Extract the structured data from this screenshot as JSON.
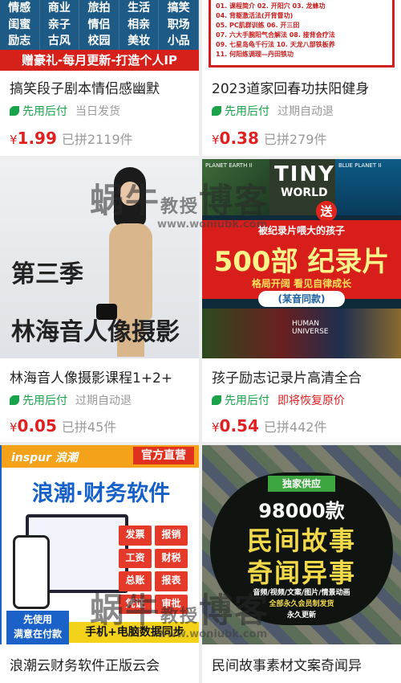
{
  "products": [
    {
      "title": "搞笑段子剧本情侣感幽默",
      "pay_badge": "先用后付",
      "shipping": "当日发货",
      "currency": "¥",
      "price": "1.99",
      "sold": "已拼2119件",
      "banner": {
        "tags": [
          "情感",
          "商业",
          "旅拍",
          "生活",
          "搞笑",
          "闺蜜",
          "亲子",
          "情侣",
          "相亲",
          "职场",
          "励志",
          "古风",
          "校园",
          "美妆",
          "小品"
        ],
        "strip": "赠豪礼-每月更新-打造个人IP"
      }
    },
    {
      "title": "2023道家回春功扶阳健身",
      "pay_badge": "先用后付",
      "shipping": "过期自动退",
      "currency": "¥",
      "price": "0.38",
      "sold": "已拼279件",
      "banner": {
        "lines": [
          "01. 课程简介  02. 开阳穴  03. 龙蜂功",
          "04. 背躯激活法(开背督功)",
          "05. PC肌群训练  06. 开三田",
          "07. 六大手腕阳气合解法  08. 接背会疗法",
          "09. 七星岛龟千行法  10. 天龙八部铁板养",
          "11. 何阳练调理—丹田铁功"
        ]
      }
    },
    {
      "title": "林海音人像摄影课程1+2+",
      "pay_badge": "先用后付",
      "shipping": "过期自动退",
      "currency": "¥",
      "price": "0.05",
      "sold": "已拼45件",
      "banner": {
        "season": "第三季",
        "name": "林海音人像摄影"
      }
    },
    {
      "title": "孩子励志记录片高清全合",
      "pay_badge": "先用后付",
      "shipping": "即将恢复原价",
      "currency": "¥",
      "price": "0.54",
      "sold": "已拼442件",
      "banner": {
        "top_left": "PLANET EARTH II",
        "tiny": "TINY",
        "world": "WORLD",
        "blue": "BLUE PLANET II",
        "send": "送",
        "pitch": "被纪录片喂大的孩子",
        "big": "500部 纪录片",
        "slogan": "格局开阔 看见自律成长",
        "same": "(某音同款)",
        "human": "HUMAN UNIVERSE"
      }
    },
    {
      "title": "浪潮云财务软件正版云会",
      "banner": {
        "brand": "inspur 浪潮",
        "official": "官方直营",
        "headline": "浪潮·财务软件",
        "buttons": [
          "发票",
          "报销",
          "工资",
          "财税",
          "总账",
          "报表",
          "凭证",
          "审批"
        ],
        "tag_line1": "先使用",
        "tag_line2": "满意在付款",
        "sync": "手机+电脑数据同步"
      }
    },
    {
      "title": "民间故事素材文案奇闻异",
      "banner": {
        "exclusive": "独家供应",
        "count": "98000款",
        "line1": "民间故事",
        "line2": "奇闻异事",
        "sub1": "音频/视频/文案/图片/情景动画",
        "sub2": "全部永久会员制发货",
        "sub3": "永久更新"
      }
    }
  ],
  "watermark": {
    "brand": "蜗牛",
    "teach": "教授",
    "blog": "博客",
    "url": "www.woniubk.com"
  },
  "colors": {
    "price_red": "#e02020",
    "pay_green": "#1aa34a",
    "muted": "#999999"
  }
}
